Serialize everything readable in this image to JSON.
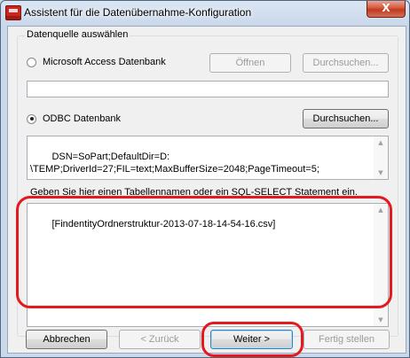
{
  "window": {
    "title": "Assistent für die Datenübernahme-Konfiguration",
    "close_glyph": "X"
  },
  "group": {
    "legend": "Datenquelle auswählen"
  },
  "access": {
    "label": "Microsoft Access Datenbank",
    "open_button": "Öffnen",
    "browse_button": "Durchsuchen...",
    "path_value": ""
  },
  "odbc": {
    "label": "ODBC Datenbank",
    "browse_button": "Durchsuchen...",
    "connection_string": "DSN=SoPart;DefaultDir=D:\n\\TEMP;DriverId=27;FIL=text;MaxBufferSize=2048;PageTimeout=5;"
  },
  "query": {
    "prompt": "Geben Sie hier einen Tabellennamen oder ein SQL-SELECT Statement ein.",
    "value": "[FindentityOrdnerstruktur-2013-07-18-14-54-16.csv]"
  },
  "footer": {
    "cancel": "Abbrechen",
    "back": "< Zurück",
    "next": "Weiter >",
    "finish": "Fertig stellen"
  },
  "colors": {
    "annotation": "#e3191f",
    "close_button": "#c2391c",
    "title_bar": "#c9d8eb"
  }
}
